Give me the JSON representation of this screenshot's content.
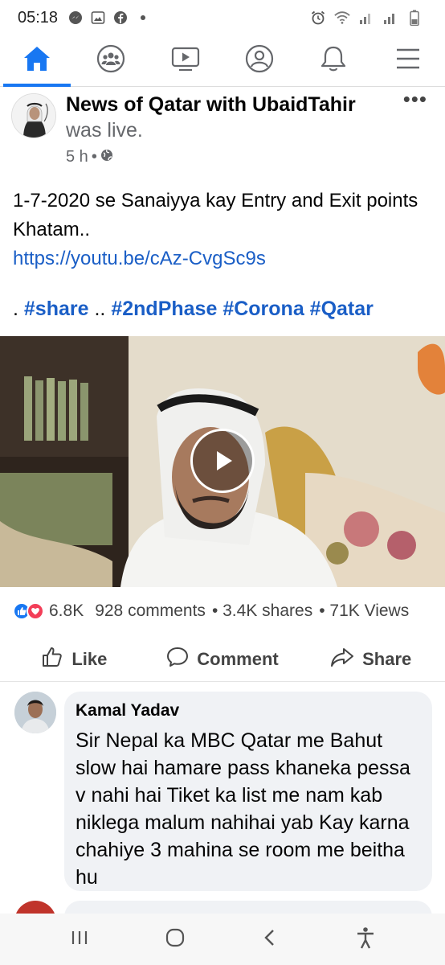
{
  "status_bar": {
    "time": "05:18",
    "left_icons": [
      "messenger-icon",
      "photos-icon",
      "facebook-icon",
      "dot-icon"
    ],
    "right_icons": [
      "alarm-icon",
      "wifi-icon",
      "signal-icon",
      "signal-icon-2",
      "battery-icon"
    ]
  },
  "nav": {
    "items": [
      {
        "name": "home",
        "icon": "home-icon",
        "active": true
      },
      {
        "name": "groups",
        "icon": "groups-icon",
        "active": false
      },
      {
        "name": "watch",
        "icon": "watch-icon",
        "active": false
      },
      {
        "name": "profile",
        "icon": "profile-icon",
        "active": false
      },
      {
        "name": "notifications",
        "icon": "bell-icon",
        "active": false
      },
      {
        "name": "menu",
        "icon": "menu-icon",
        "active": false
      }
    ],
    "accent": "#1877f2"
  },
  "post": {
    "author": "News of Qatar with UbaidTahir",
    "action": "was live.",
    "time": "5 h",
    "separator": "•",
    "audience_icon": "globe-icon",
    "more": "•••",
    "text_line": "1-7-2020 se Sanaiyya kay Entry and Exit points Khatam..",
    "link": "https://youtu.be/cAz-CvgSc9s",
    "hashtags_prefix": ".",
    "hashtag_1": "#share",
    "hashtag_sep": "..",
    "hashtag_2": "#2ndPhase",
    "hashtag_3": "#Corona",
    "hashtag_4": "#Qatar",
    "link_color": "#1a5ec6"
  },
  "stats": {
    "reactions": "6.8K",
    "comments": "928 comments",
    "shares": "• 3.4K shares",
    "views": "• 71K Views"
  },
  "actions": {
    "like": "Like",
    "comment": "Comment",
    "share": "Share"
  },
  "comment": {
    "name": "Kamal Yadav",
    "text": "Sir Nepal ka MBC  Qatar me Bahut slow hai hamare pass khaneka pessa v nahi hai Tiket ka list me nam kab niklega  malum nahihai yab Kay karna chahiye 3 mahina se room me beitha hu"
  },
  "system_nav": {
    "items": [
      "recents-icon",
      "home-circle-icon",
      "back-icon",
      "accessibility-icon"
    ]
  }
}
